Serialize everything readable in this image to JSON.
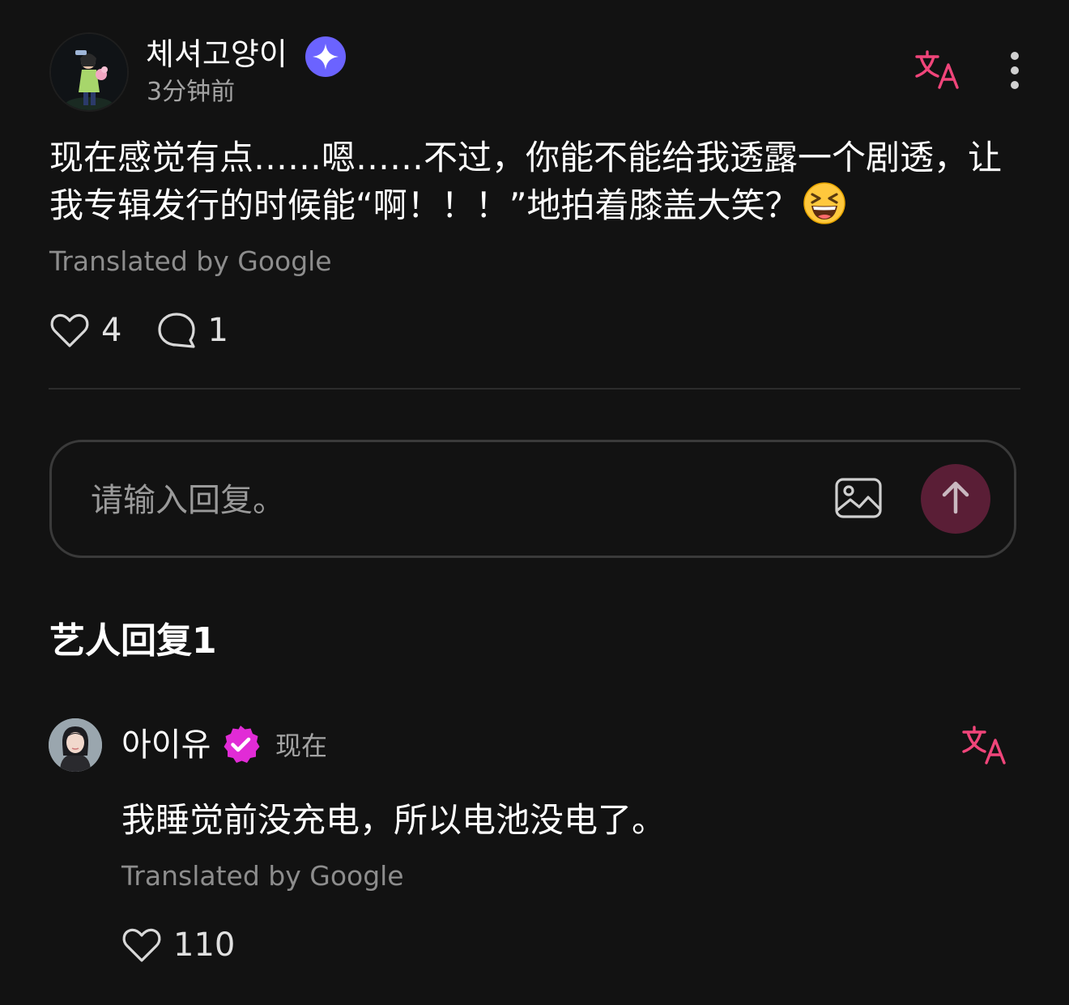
{
  "colors": {
    "background": "#121212",
    "accent_pink": "#f0457a",
    "verified_blue": "#6b63ff",
    "verified_pink": "#e12bd6",
    "send_button": "#5a1e36",
    "muted_text": "#a4a4a4"
  },
  "post": {
    "author": "체셔고양이",
    "time": "3分钟前",
    "text": "现在感觉有点……嗯……不过，你能不能给我透露一个剧透，让我专辑发行的时候能“啊！！！”地拍着膝盖大笑？",
    "emoji": "grinning-squinting-face",
    "translated_by": "Translated by Google",
    "likes": "4",
    "comments": "1",
    "icons": {
      "verified": "sparkle-badge-icon",
      "translate": "translate-icon",
      "more": "more-vertical-icon"
    }
  },
  "reply_input": {
    "placeholder": "请输入回复。",
    "image_icon": "image-icon",
    "send_icon": "arrow-up-icon"
  },
  "artist_replies": {
    "title": "艺人回复1",
    "items": [
      {
        "author": "아이유",
        "time": "现在",
        "text": "我睡觉前没充电，所以电池没电了。",
        "translated_by": "Translated by Google",
        "likes": "110"
      }
    ]
  }
}
